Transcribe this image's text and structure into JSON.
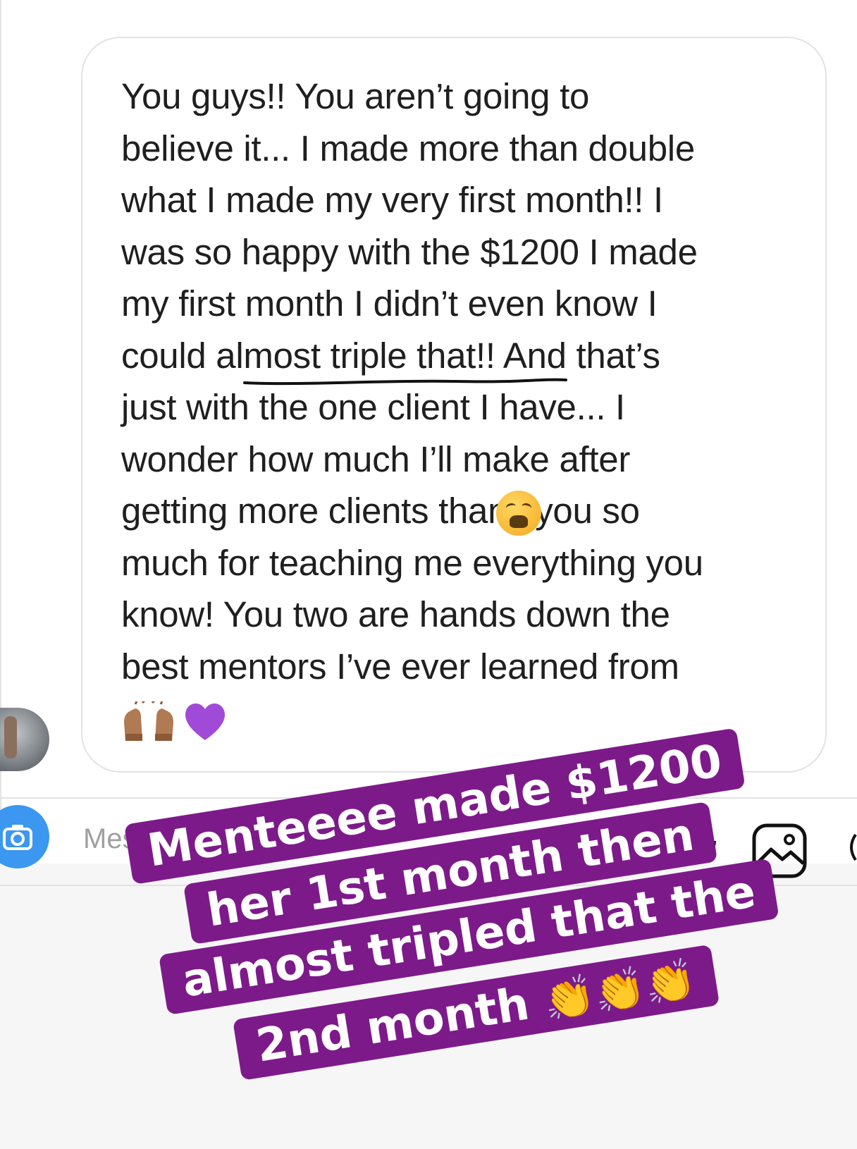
{
  "message": {
    "text": "You guys!! You aren’t going to\nbelieve it... I made more than double\nwhat I made my very first month!! I\nwas so happy with the $1200 I made\nmy first month I didn’t even know I\ncould almost triple that!! And that’s\njust with the one client I have... I\nwonder how much I’ll make after\ngetting more clients         thank you so\nmuch for teaching me everything you\nknow! You two are hands down the\nbest mentors I’ve ever learned from",
    "emojis": [
      "weary-face",
      "raising-hands",
      "purple-heart"
    ]
  },
  "composer": {
    "placeholder": "Mes"
  },
  "story_caption": {
    "line1": "Menteeee made $1200",
    "line2": "her 1st month then",
    "line3": "almost tripled that the",
    "line4": "2nd month",
    "line4_emoji": "👏👏👏",
    "background_color": "#7d1a8a",
    "text_color": "#ffffff"
  }
}
